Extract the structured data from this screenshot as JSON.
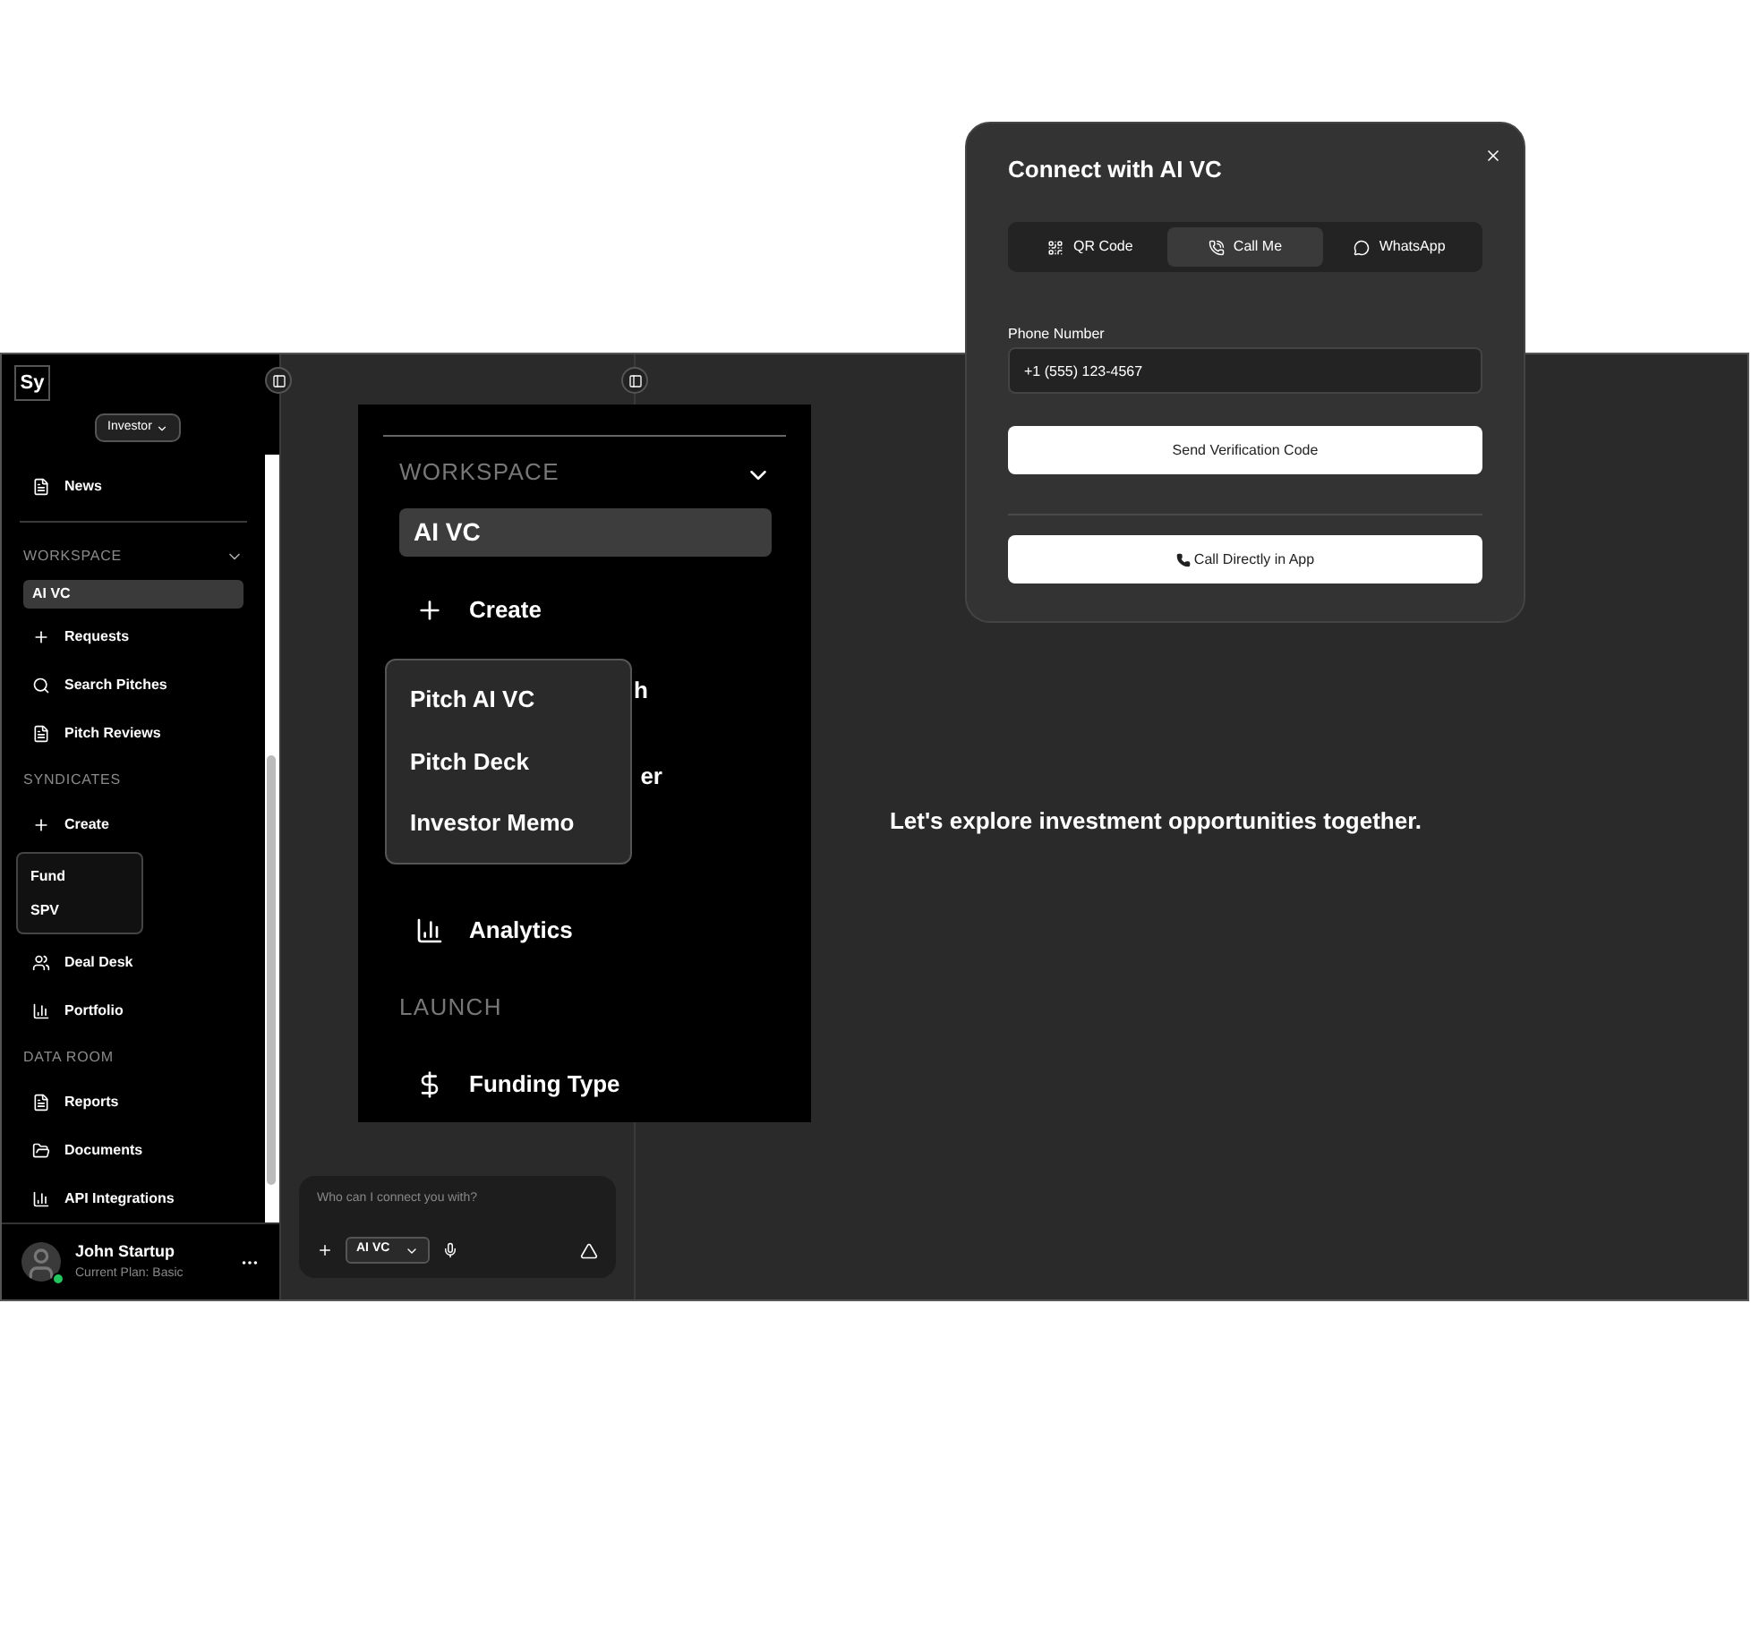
{
  "sidebar": {
    "logo": "Sy",
    "role_dropdown": "Investor",
    "items": [
      {
        "kind": "link",
        "label": "News",
        "selected": false
      },
      {
        "kind": "divider"
      },
      {
        "kind": "header",
        "label": "WORKSPACE",
        "collapsible": true
      },
      {
        "kind": "link",
        "label": "AI VC",
        "selected": true
      },
      {
        "kind": "link",
        "label": "Requests",
        "selected": false
      },
      {
        "kind": "link",
        "label": "Search Pitches",
        "selected": false
      },
      {
        "kind": "link",
        "label": "Pitch Reviews",
        "selected": false
      },
      {
        "kind": "header",
        "label": "SYNDICATES",
        "collapsible": false
      },
      {
        "kind": "link",
        "label": "Create",
        "selected": false
      },
      {
        "kind": "submenu",
        "items": [
          "Fund",
          "SPV"
        ]
      },
      {
        "kind": "link",
        "label": "Deal Desk",
        "selected": false
      },
      {
        "kind": "link",
        "label": "Portfolio",
        "selected": false
      },
      {
        "kind": "header",
        "label": "DATA ROOM",
        "collapsible": false
      },
      {
        "kind": "link",
        "label": "Reports",
        "selected": false
      },
      {
        "kind": "link",
        "label": "Documents",
        "selected": false
      },
      {
        "kind": "link",
        "label": "API Integrations",
        "selected": false
      }
    ],
    "user": {
      "name": "John Startup",
      "plan": "Current Plan: Basic",
      "online": true
    }
  },
  "chat": {
    "placeholder": "Who can I connect you with?",
    "agent": "AI VC"
  },
  "main": {
    "message": "Let's explore investment opportunities together."
  },
  "zoomed_panel": {
    "items": [
      {
        "kind": "header",
        "label": "WORKSPACE"
      },
      {
        "kind": "link",
        "label": "AI VC",
        "selected": true
      },
      {
        "kind": "link",
        "label": "Create",
        "selected": false
      },
      {
        "kind": "fragment",
        "label": "h"
      },
      {
        "kind": "fragment",
        "label": "er"
      },
      {
        "kind": "link",
        "label": "Analytics",
        "selected": false
      },
      {
        "kind": "header",
        "label": "LAUNCH"
      },
      {
        "kind": "link",
        "label": "Funding Type",
        "selected": false
      }
    ]
  },
  "create_menu": {
    "items": [
      "Pitch AI VC",
      "Pitch Deck",
      "Investor Memo"
    ]
  },
  "modal": {
    "title": "Connect with AI VC",
    "tabs": [
      {
        "label": "QR Code",
        "selected": false
      },
      {
        "label": "Call Me",
        "selected": true
      },
      {
        "label": "WhatsApp",
        "selected": false
      }
    ],
    "phone_label": "Phone Number",
    "phone_value": "+1 (555) 123-4567",
    "send_button": "Send Verification Code",
    "call_button": "Call Directly in App"
  }
}
